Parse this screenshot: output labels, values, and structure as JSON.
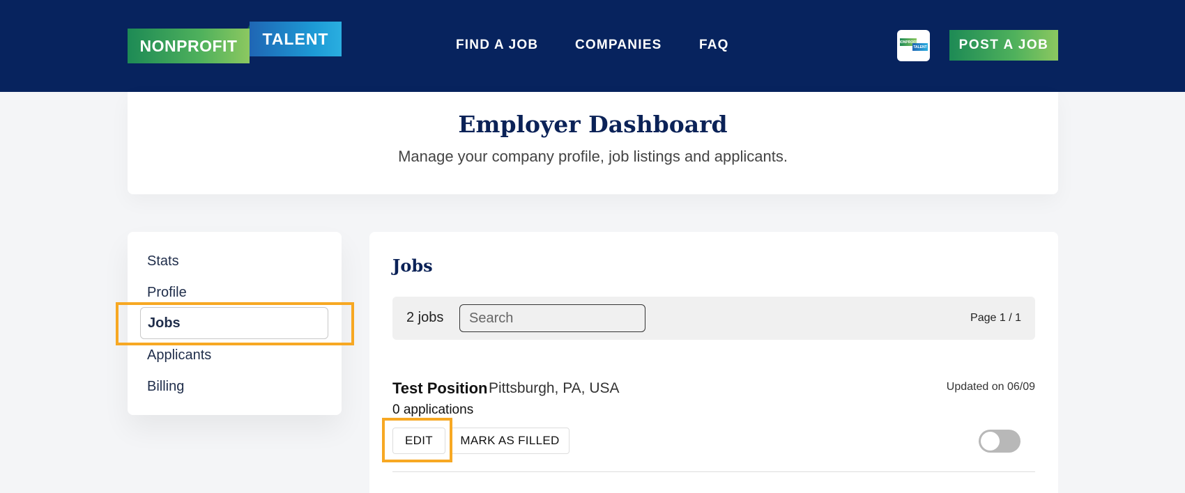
{
  "header": {
    "logo_left": "NONPROFIT",
    "logo_right": "TALENT",
    "nav": [
      "FIND A JOB",
      "COMPANIES",
      "FAQ"
    ],
    "avatar_top": "NONPROFIT",
    "avatar_bottom": "TALENT",
    "post_button": "POST A JOB"
  },
  "hero": {
    "title": "Employer Dashboard",
    "subtitle": "Manage your company profile, job listings and applicants."
  },
  "sidebar": {
    "items": [
      "Stats",
      "Profile",
      "Jobs",
      "Applicants",
      "Billing"
    ],
    "active": "Jobs"
  },
  "main": {
    "title": "Jobs",
    "job_count": "2 jobs",
    "search_placeholder": "Search",
    "page_info": "Page 1 / 1",
    "jobs": [
      {
        "title": "Test Position",
        "location": "Pittsburgh, PA, USA",
        "updated": "Updated on 06/09",
        "applications": "0 applications",
        "edit_label": "EDIT",
        "filled_label": "MARK AS FILLED",
        "active": false
      }
    ]
  },
  "colors": {
    "header_bg": "#07235e",
    "highlight": "#f7a823",
    "heading": "#0b2257"
  }
}
